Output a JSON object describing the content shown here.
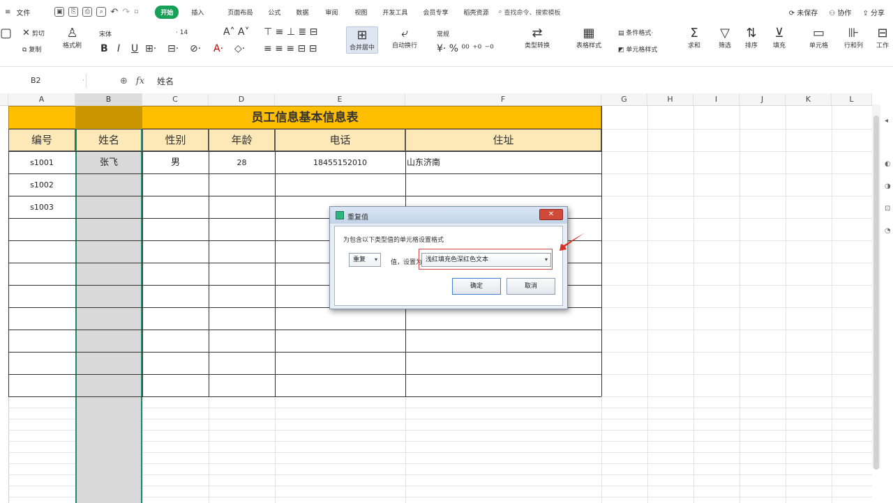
{
  "menubar": {
    "items": [
      "≡",
      "文件"
    ],
    "tabs": [
      "开始",
      "插入",
      "页面布局",
      "公式",
      "数据",
      "审阅",
      "视图",
      "开发工具",
      "会员专享",
      "稻壳资源"
    ],
    "active_tab": "开始",
    "search": "查找命令、搜索模板",
    "right": [
      "未保存",
      "协作",
      "分享"
    ]
  },
  "ribbon": {
    "cut": "剪切",
    "copy": "复制",
    "format_painter": "格式刷",
    "font_name": "宋体",
    "font_size": "14",
    "merge_center": "合并居中",
    "wrap_text": "自动换行",
    "number_format": "常规",
    "type_convert": "类型转换",
    "table_style": "表格样式",
    "cell_style": "单元格样式",
    "sum": "求和",
    "filter": "筛选",
    "sort": "排序",
    "fill": "填充",
    "cell": "单元格",
    "row_col": "行和列",
    "worksheet": "工作"
  },
  "formula_bar": {
    "cell_ref": "B2",
    "fx": "fx",
    "value": "姓名"
  },
  "sheet": {
    "columns": [
      "A",
      "B",
      "C",
      "D",
      "E",
      "F",
      "G",
      "H",
      "I",
      "J",
      "K",
      "L"
    ],
    "title": "员工信息基本信息表",
    "headers": [
      "编号",
      "姓名",
      "性别",
      "年龄",
      "电话",
      "住址"
    ],
    "rows": [
      [
        "s1001",
        "张飞",
        "男",
        "28",
        "18455152010",
        "山东济南"
      ],
      [
        "s1002",
        "",
        "",
        "",
        "",
        ""
      ],
      [
        "s1003",
        "",
        "",
        "",
        "",
        ""
      ]
    ]
  },
  "dialog": {
    "title": "重复值",
    "prompt": "为包含以下类型值的单元格设置格式",
    "type_value": "重复",
    "set_label": "值，设置为",
    "format_value": "浅红填充色深红色文本",
    "ok": "确定",
    "cancel": "取消",
    "close": "✕"
  },
  "colors": {
    "title_fill": "#ffbf00",
    "header_fill": "#fde9b8",
    "active_tab": "#18a058",
    "selection_border": "#1b8a6b"
  }
}
